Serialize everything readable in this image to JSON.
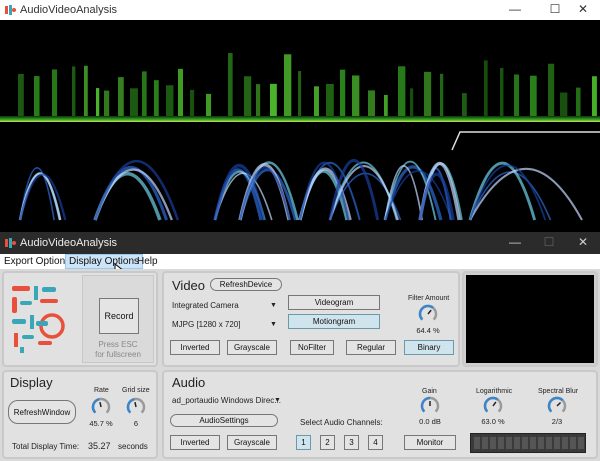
{
  "outer_window": {
    "title": "AudioVideoAnalysis",
    "minimize_icon": "minimize-icon",
    "maximize_icon": "maximize-icon",
    "close_icon": "close-icon"
  },
  "app_window": {
    "title": "AudioVideoAnalysis"
  },
  "menu": {
    "items": [
      "Export Options",
      "Display Options",
      "Help"
    ],
    "active": "Display Options"
  },
  "record": {
    "label": "Record",
    "hint_line1": "Press ESC",
    "hint_line2": "for fullscreen"
  },
  "video": {
    "header": "Video",
    "refresh_label": "RefreshDevice",
    "device": "Integrated Camera",
    "format": "MJPG [1280 x 720]",
    "videogram_label": "Videogram",
    "motiongram_label": "Motiongram",
    "filter_amount_label": "Filter Amount",
    "filter_amount_value": "64.4 %",
    "filter_amount_level": 0.644,
    "buttons": [
      "Inverted",
      "Grayscale",
      "NoFilter",
      "Regular",
      "Binary"
    ],
    "selected": [
      "Motiongram",
      "Binary"
    ]
  },
  "display": {
    "header": "Display",
    "refresh_label": "RefreshWindow",
    "rate_label": "Rate",
    "rate_value": "45.7 %",
    "rate_level": 0.457,
    "grid_label": "Grid size",
    "grid_value": "6",
    "total_label": "Total Display Time:",
    "total_value": "35.27",
    "total_unit": "seconds"
  },
  "audio": {
    "header": "Audio",
    "device": "ad_portaudio Windows Direc...",
    "settings_label": "AudioSettings",
    "gain_label": "Gain",
    "gain_value": "0.0 dB",
    "gain_level": 0.5,
    "log_label": "Logarithmic",
    "log_value": "63.0 %",
    "log_level": 0.63,
    "blur_label": "Spectral Blur",
    "blur_value": "2/3",
    "blur_level": 0.667,
    "channels_label": "Select Audio Channels:",
    "channels": [
      "1",
      "2",
      "3",
      "4"
    ],
    "selected_channel": "1",
    "inverted_label": "Inverted",
    "grayscale_label": "Grayscale",
    "monitor_label": "Monitor"
  },
  "colors": {
    "accent_red": "#e8503c",
    "accent_teal": "#3aa7b8",
    "selected_btn": "#cfe4ec",
    "spectrogram_green": "#6ee04a"
  }
}
